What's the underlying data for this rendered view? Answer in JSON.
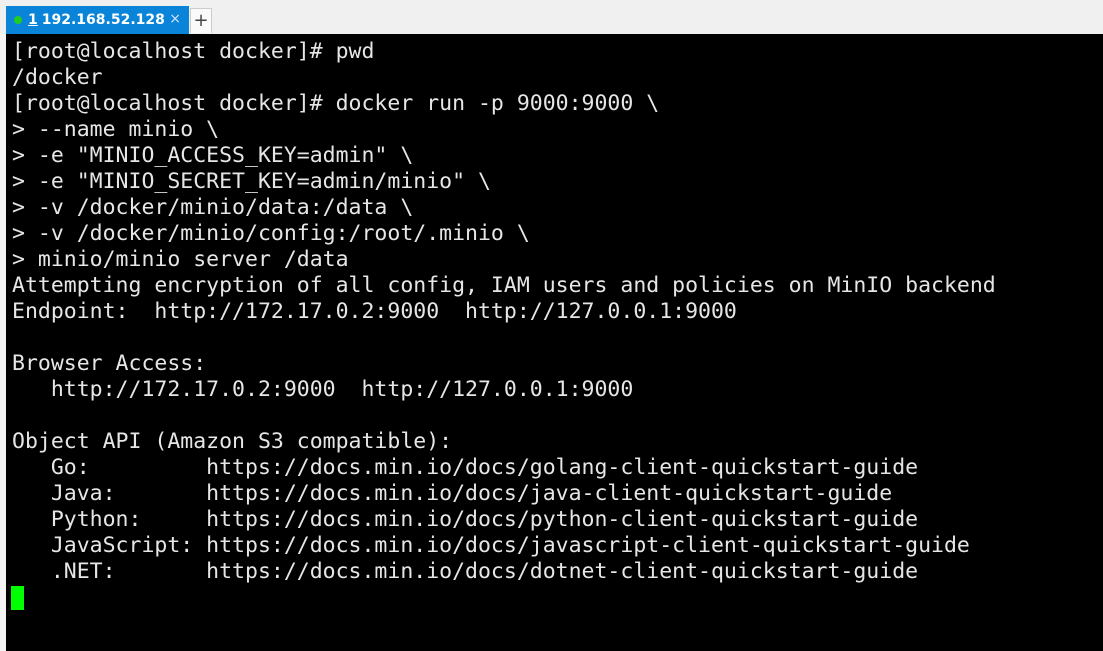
{
  "tab": {
    "number": "1",
    "title": "192.168.52.128",
    "close": "×",
    "status_color": "#22cc22"
  },
  "new_tab": "+",
  "terminal": {
    "lines": [
      "[root@localhost docker]# pwd",
      "/docker",
      "[root@localhost docker]# docker run -p 9000:9000 \\",
      "> --name minio \\",
      "> -e \"MINIO_ACCESS_KEY=admin\" \\",
      "> -e \"MINIO_SECRET_KEY=admin/minio\" \\",
      "> -v /docker/minio/data:/data \\",
      "> -v /docker/minio/config:/root/.minio \\",
      "> minio/minio server /data",
      "Attempting encryption of all config, IAM users and policies on MinIO backend",
      "Endpoint:  http://172.17.0.2:9000  http://127.0.0.1:9000",
      "",
      "Browser Access:",
      "   http://172.17.0.2:9000  http://127.0.0.1:9000",
      "",
      "Object API (Amazon S3 compatible):",
      "   Go:         https://docs.min.io/docs/golang-client-quickstart-guide",
      "   Java:       https://docs.min.io/docs/java-client-quickstart-guide",
      "   Python:     https://docs.min.io/docs/python-client-quickstart-guide",
      "   JavaScript: https://docs.min.io/docs/javascript-client-quickstart-guide",
      "   .NET:       https://docs.min.io/docs/dotnet-client-quickstart-guide"
    ],
    "cursor_color": "#00ff00"
  }
}
